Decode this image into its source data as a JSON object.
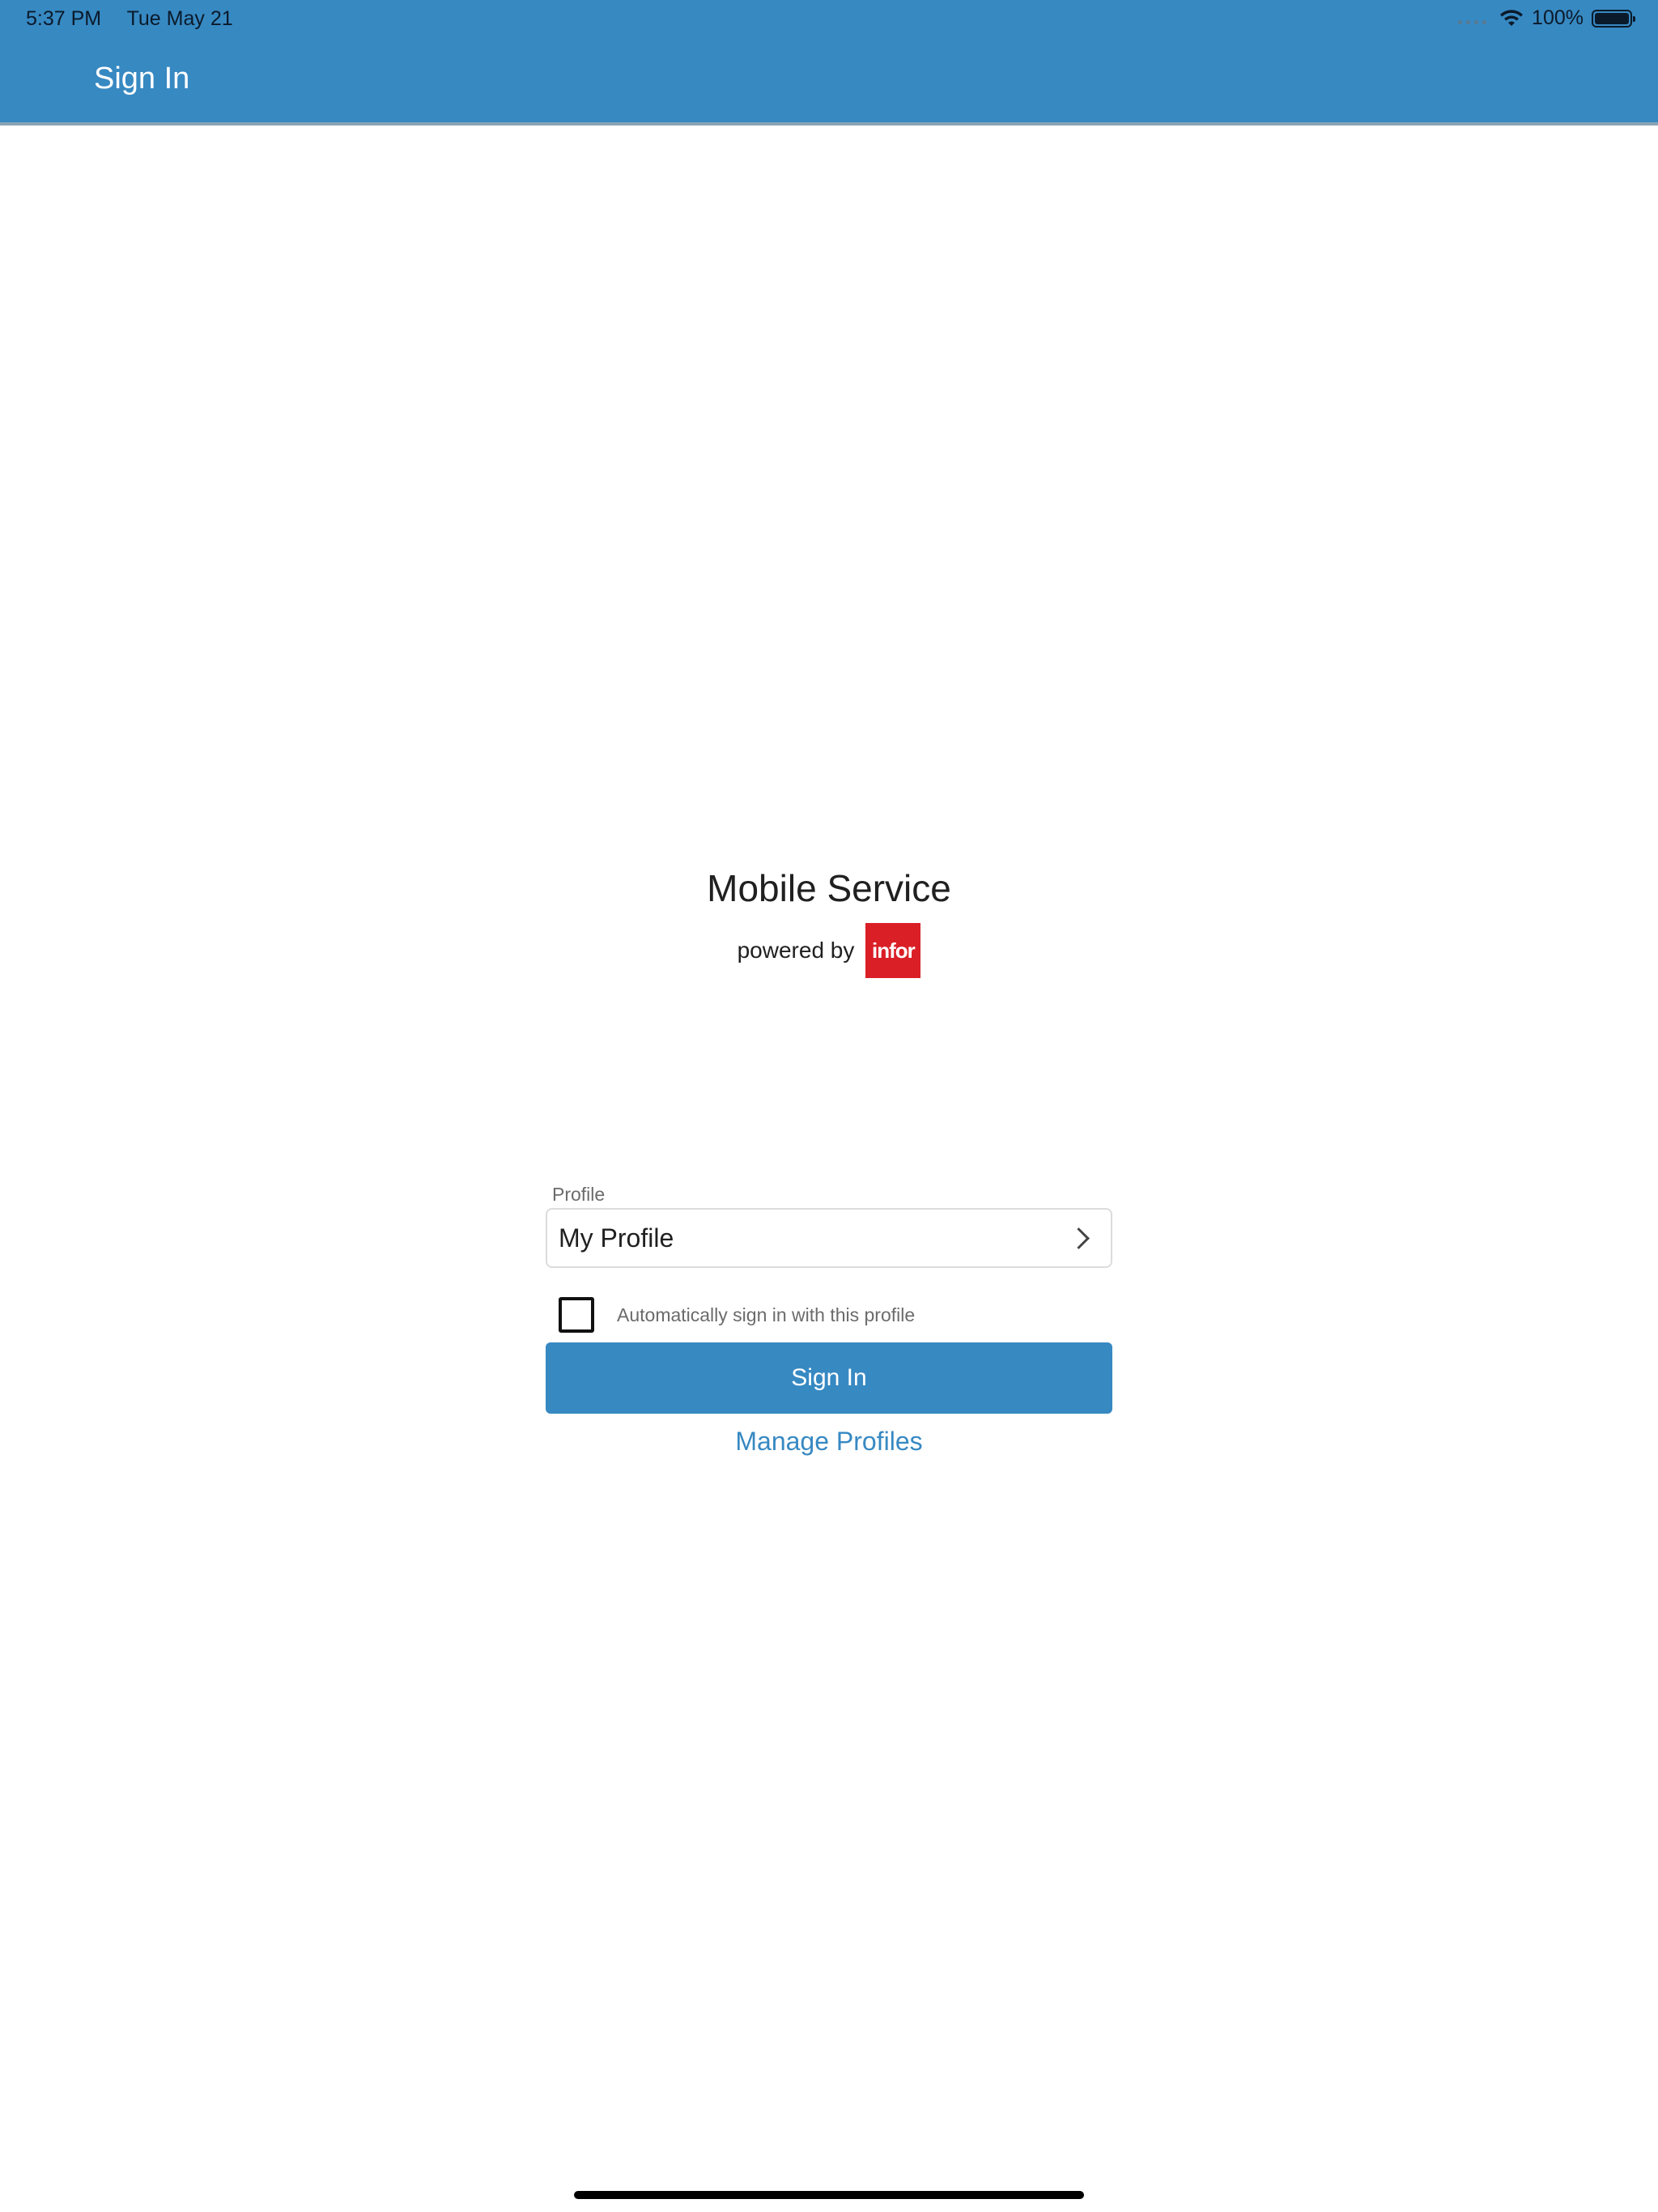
{
  "status_bar": {
    "time": "5:37 PM",
    "date": "Tue May 21",
    "battery": "100%",
    "wifi_icon": "wifi-icon",
    "battery_icon": "battery-icon"
  },
  "header": {
    "title": "Sign In",
    "background_color": "#3789c2"
  },
  "branding": {
    "app_name": "Mobile Service",
    "powered_by": "powered by",
    "logo_text": "infor",
    "logo_color": "#da1f26"
  },
  "form": {
    "profile_label": "Profile",
    "profile_value": "My Profile",
    "auto_signin_label": "Automatically sign in with this profile",
    "auto_signin_checked": false,
    "signin_button_label": "Sign In",
    "manage_profiles_label": "Manage Profiles",
    "accent_color": "#3789c2"
  }
}
